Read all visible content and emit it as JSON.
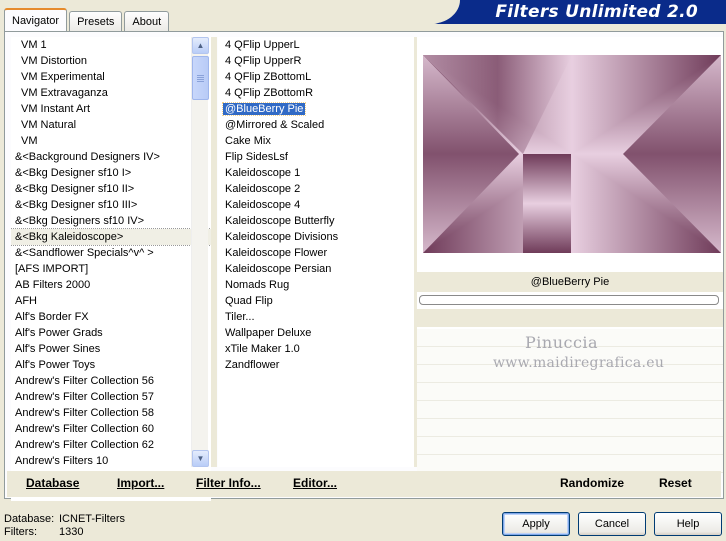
{
  "tabs": [
    {
      "label": "Navigator"
    },
    {
      "label": "Presets"
    },
    {
      "label": "About"
    }
  ],
  "banner": {
    "title": "Filters Unlimited 2.0"
  },
  "categories": [
    {
      "label": "VM 1"
    },
    {
      "label": "VM Distortion"
    },
    {
      "label": "VM Experimental"
    },
    {
      "label": "VM Extravaganza"
    },
    {
      "label": "VM Instant Art"
    },
    {
      "label": "VM Natural"
    },
    {
      "label": "VM"
    },
    {
      "label": "&<Background Designers IV>"
    },
    {
      "label": "&<Bkg Designer sf10 I>"
    },
    {
      "label": "&<Bkg Designer sf10 II>"
    },
    {
      "label": "&<Bkg Designer sf10 III>"
    },
    {
      "label": "&<Bkg Designers sf10 IV>"
    },
    {
      "label": "&<Bkg Kaleidoscope>"
    },
    {
      "label": "&<Sandflower Specials^v^ >"
    },
    {
      "label": "[AFS IMPORT]"
    },
    {
      "label": "AB Filters 2000"
    },
    {
      "label": "AFH"
    },
    {
      "label": "Alf's Border FX"
    },
    {
      "label": "Alf's Power Grads"
    },
    {
      "label": "Alf's Power Sines"
    },
    {
      "label": "Alf's Power Toys"
    },
    {
      "label": "Andrew's Filter Collection 56"
    },
    {
      "label": "Andrew's Filter Collection 57"
    },
    {
      "label": "Andrew's Filter Collection 58"
    },
    {
      "label": "Andrew's Filter Collection 60"
    },
    {
      "label": "Andrew's Filter Collection 62"
    },
    {
      "label": "Andrew's Filters 10"
    }
  ],
  "filters": [
    {
      "label": "4 QFlip UpperL"
    },
    {
      "label": "4 QFlip UpperR"
    },
    {
      "label": "4 QFlip ZBottomL"
    },
    {
      "label": "4 QFlip ZBottomR"
    },
    {
      "label": "@BlueBerry Pie"
    },
    {
      "label": "@Mirrored & Scaled"
    },
    {
      "label": "Cake Mix"
    },
    {
      "label": "Flip SidesLsf"
    },
    {
      "label": "Kaleidoscope 1"
    },
    {
      "label": "Kaleidoscope 2"
    },
    {
      "label": "Kaleidoscope 4"
    },
    {
      "label": "Kaleidoscope Butterfly"
    },
    {
      "label": "Kaleidoscope Divisions"
    },
    {
      "label": "Kaleidoscope Flower"
    },
    {
      "label": "Kaleidoscope Persian"
    },
    {
      "label": "Nomads Rug"
    },
    {
      "label": "Quad Flip"
    },
    {
      "label": "Tiler..."
    },
    {
      "label": "Wallpaper Deluxe"
    },
    {
      "label": "xTile Maker 1.0"
    },
    {
      "label": "Zandflower"
    }
  ],
  "selected_filter_name": "@BlueBerry Pie",
  "watermark": {
    "line1": "Pinuccia",
    "line2": "www.maidiregrafica.eu"
  },
  "bottom_bar": {
    "database": "Database",
    "import": "Import...",
    "filter_info": "Filter Info...",
    "editor": "Editor...",
    "randomize": "Randomize",
    "reset": "Reset"
  },
  "footer": {
    "database_label": "Database:",
    "database_value": "ICNET-Filters",
    "filters_label": "Filters:",
    "filters_value": "1330"
  },
  "buttons": {
    "apply": "Apply",
    "cancel": "Cancel",
    "help": "Help"
  },
  "colors": {
    "banner": "#0a2b8a",
    "selection": "#316ac5",
    "preview_dark": "#6f3b59",
    "preview_light": "#e8cfe0"
  }
}
